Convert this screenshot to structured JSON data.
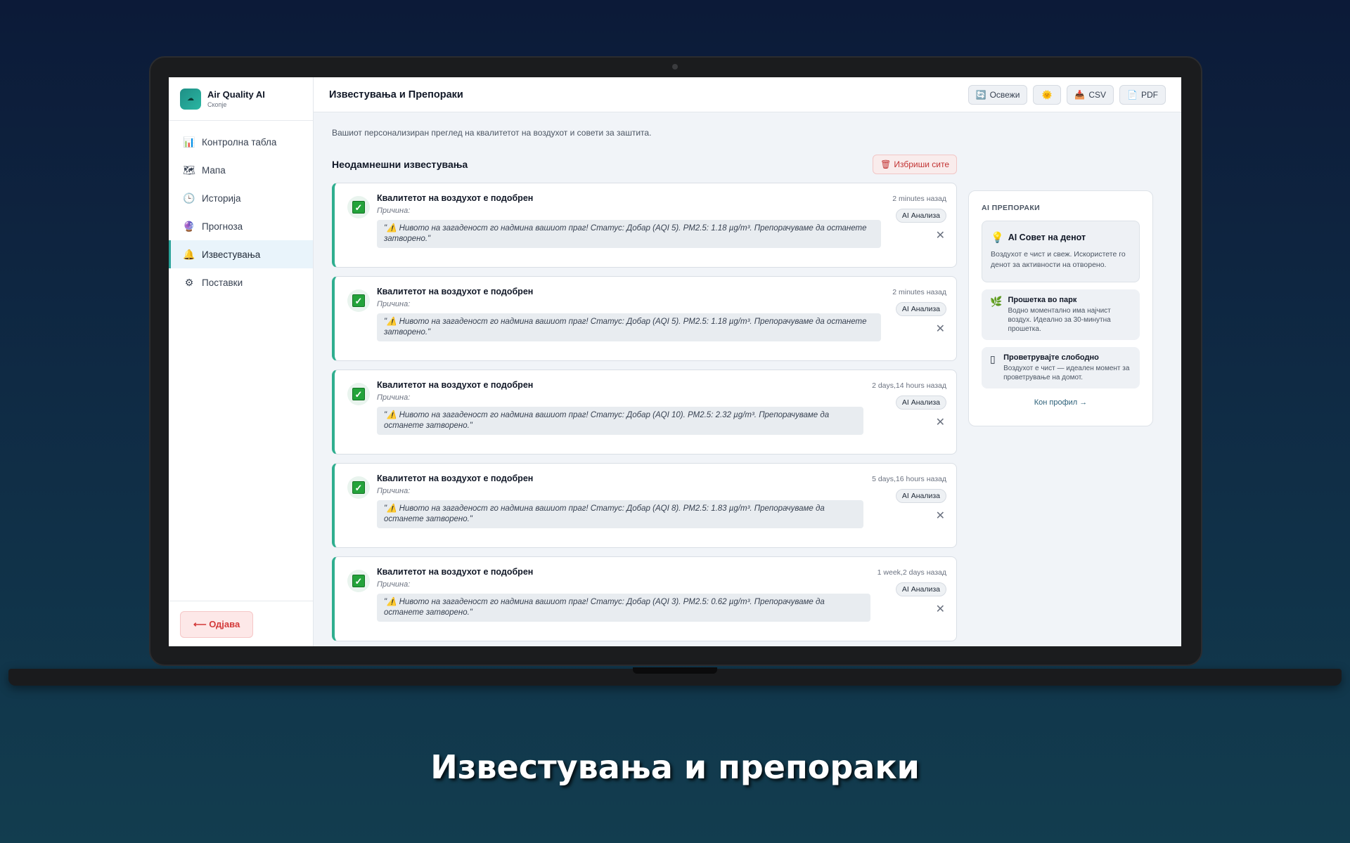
{
  "app": {
    "name": "Air Quality AI",
    "city": "Скопје"
  },
  "sidebar": {
    "items": [
      {
        "label": "Контролна табла",
        "icon": "bar-chart-icon"
      },
      {
        "label": "Мапа",
        "icon": "map-icon"
      },
      {
        "label": "Историја",
        "icon": "clock-icon"
      },
      {
        "label": "Прогноза",
        "icon": "crystal-ball-icon"
      },
      {
        "label": "Известувања",
        "icon": "bell-icon",
        "active": true
      },
      {
        "label": "Поставки",
        "icon": "gear-icon"
      }
    ],
    "logout_label": "⟵ Одјава"
  },
  "header": {
    "title": "Известувања и Препораки",
    "refresh_label": "Освежи",
    "csv_label": "CSV",
    "pdf_label": "PDF"
  },
  "main": {
    "subtitle": "Вашиот персонализиран преглед на квалитетот на воздухот и совети за заштита.",
    "section_title": "Неодамнешни известувања",
    "clear_all_label": "Избриши сите"
  },
  "alerts": [
    {
      "title": "Квалитетот на воздухот е подобрен",
      "reason_label": "Причина:",
      "quote": "\"⚠️ Нивото на загаденост го надмина вашиот праг! Статус: Добар (AQI 5). PM2.5: 1.18 µg/m³. Препорачуваме да останете затворено.\"",
      "time": "2 minutes назад",
      "badge": "AI Анализа"
    },
    {
      "title": "Квалитетот на воздухот е подобрен",
      "reason_label": "Причина:",
      "quote": "\"⚠️ Нивото на загаденост го надмина вашиот праг! Статус: Добар (AQI 5). PM2.5: 1.18 µg/m³. Препорачуваме да останете затворено.\"",
      "time": "2 minutes назад",
      "badge": "AI Анализа"
    },
    {
      "title": "Квалитетот на воздухот е подобрен",
      "reason_label": "Причина:",
      "quote": "\"⚠️ Нивото на загаденост го надмина вашиот праг! Статус: Добар (AQI 10). PM2.5: 2.32 µg/m³. Препорачуваме да останете затворено.\"",
      "time": "2 days,14 hours назад",
      "badge": "AI Анализа"
    },
    {
      "title": "Квалитетот на воздухот е подобрен",
      "reason_label": "Причина:",
      "quote": "\"⚠️ Нивото на загаденост го надмина вашиот праг! Статус: Добар (AQI 8). PM2.5: 1.83 µg/m³. Препорачуваме да останете затворено.\"",
      "time": "5 days,16 hours назад",
      "badge": "AI Анализа"
    },
    {
      "title": "Квалитетот на воздухот е подобрен",
      "reason_label": "Причина:",
      "quote": "\"⚠️ Нивото на загаденост го надмина вашиот праг! Статус: Добар (AQI 3). PM2.5: 0.62 µg/m³. Препорачуваме да останете затворено.\"",
      "time": "1 week,2 days назад",
      "badge": "AI Анализа"
    }
  ],
  "recommendations": {
    "title": "AI ПРЕПОРАКИ",
    "tip_title": "AI Совет на денот",
    "tip_text": "Воздухот е чист и свеж. Искористете го денот за активности на отворено.",
    "items": [
      {
        "title": "Прошетка во парк",
        "text": "Водно моментално има најчист воздух. Идеално за 30-минутна прошетка.",
        "icon": "leaf-icon"
      },
      {
        "title": "Проветрувајте слободно",
        "text": "Воздухот е чист — идеален момент за проветрување на домот.",
        "icon": "window-icon"
      }
    ],
    "profile_link": "Кон профил →"
  },
  "caption": "Известувања и препораки",
  "colors": {
    "accent": "#2fae8f",
    "danger": "#c23434",
    "background": "#0f2a44"
  }
}
